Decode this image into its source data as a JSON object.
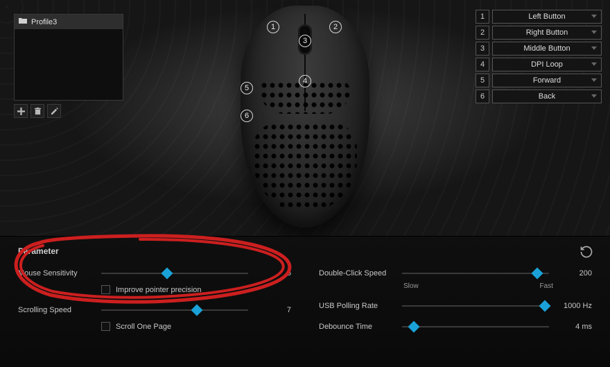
{
  "profile": {
    "selected": "Profile3"
  },
  "buttons": [
    {
      "num": "1",
      "label": "Left Button"
    },
    {
      "num": "2",
      "label": "Right Button"
    },
    {
      "num": "3",
      "label": "Middle Button"
    },
    {
      "num": "4",
      "label": "DPI Loop"
    },
    {
      "num": "5",
      "label": "Forward"
    },
    {
      "num": "6",
      "label": "Back"
    }
  ],
  "panel": {
    "title": "Parameter",
    "mouse_sensitivity": {
      "label": "Mouse Sensitivity",
      "value": "6",
      "pct": 45
    },
    "improve_precision": {
      "label": "Improve pointer precision",
      "checked": false
    },
    "scrolling_speed": {
      "label": "Scrolling Speed",
      "value": "7",
      "pct": 65
    },
    "scroll_one_page": {
      "label": "Scroll One Page",
      "checked": false
    },
    "double_click": {
      "label": "Double-Click Speed",
      "value": "200",
      "slow": "Slow",
      "fast": "Fast",
      "pct": 92
    },
    "polling": {
      "label": "USB Polling Rate",
      "value": "1000 Hz",
      "pct": 97
    },
    "debounce": {
      "label": "Debounce Time",
      "value": "4 ms",
      "pct": 8
    }
  }
}
